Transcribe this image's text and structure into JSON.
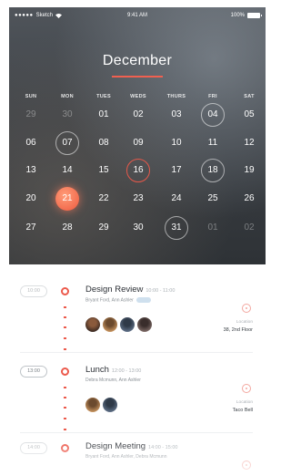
{
  "status_bar": {
    "carrier": "Sketch",
    "time": "9:41 AM",
    "battery": "100%"
  },
  "calendar": {
    "month": "December",
    "weekdays": [
      "SUN",
      "MON",
      "TUES",
      "WEDS",
      "THURS",
      "FRI",
      "SAT"
    ],
    "weeks": [
      [
        "29",
        "30",
        "01",
        "02",
        "03",
        "04",
        "05"
      ],
      [
        "06",
        "07",
        "08",
        "09",
        "10",
        "11",
        "12"
      ],
      [
        "13",
        "14",
        "15",
        "16",
        "17",
        "18",
        "19"
      ],
      [
        "20",
        "21",
        "22",
        "23",
        "24",
        "25",
        "26"
      ],
      [
        "27",
        "28",
        "29",
        "30",
        "31",
        "01",
        "02"
      ]
    ],
    "muted_days": [
      "0-0",
      "0-1",
      "4-5",
      "4-6"
    ],
    "circled_days": [
      "0-5",
      "1-1",
      "2-5",
      "4-4"
    ],
    "red_circled_days": [
      "2-3"
    ],
    "today": "3-1",
    "accent_color": "#ec5a4c"
  },
  "events": [
    {
      "time": "10:00",
      "title": "Design Review",
      "time_range": "10:00 - 11:00",
      "people": "Bryant Ford, Ann Ashler",
      "avatar_count": 4,
      "location_label": "Location",
      "location": "38, 2nd Floor"
    },
    {
      "time": "13:00",
      "title": "Lunch",
      "time_range": "12:00 - 13:00",
      "people": "Debra Mcmunn, Ann Ashler",
      "avatar_count": 2,
      "location_label": "Location",
      "location": "Taco Bell"
    },
    {
      "time": "14:00",
      "title": "Design Meeting",
      "time_range": "14:00 - 15:00",
      "people": "Bryant Ford, Ann Ashler, Debra Mcmunn",
      "avatar_count": 0,
      "location_label": "",
      "location": ""
    }
  ]
}
